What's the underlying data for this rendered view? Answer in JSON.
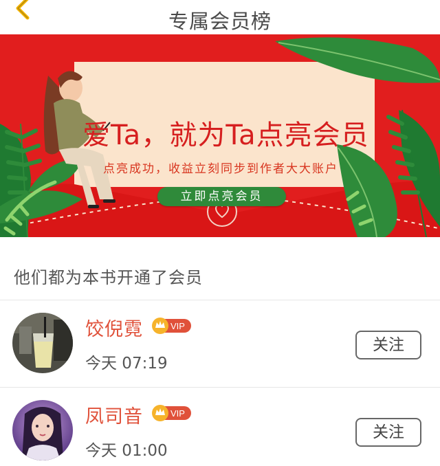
{
  "header": {
    "title": "专属会员榜",
    "back_icon": "chevron-left-icon"
  },
  "banner": {
    "headline": "爱Ta，就为Ta点亮会员",
    "subtitle": "点亮成功，收益立刻同步到作者大大账户",
    "cta_label": "立即点亮会员",
    "colors": {
      "background": "#e11e1e",
      "card": "#fbe4cc",
      "leaf": "#2e8b3a",
      "cta": "#2f8a3a"
    }
  },
  "section": {
    "title": "他们都为本书开通了会员"
  },
  "members": [
    {
      "name": "饺倪霓",
      "badge": "VIP",
      "time": "今天 07:19",
      "follow_label": "关注"
    },
    {
      "name": "凤司音",
      "badge": "VIP",
      "time": "今天 01:00",
      "follow_label": "关注"
    }
  ]
}
